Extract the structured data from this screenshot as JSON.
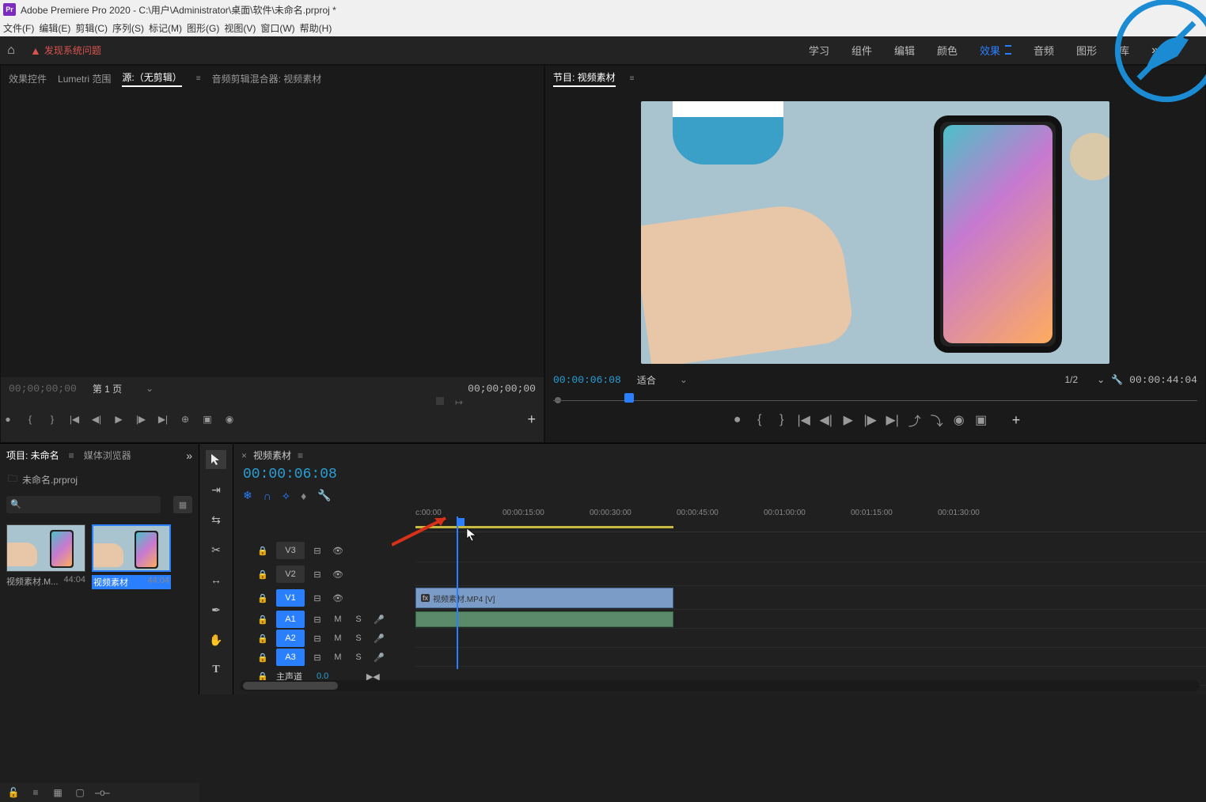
{
  "title": "Adobe Premiere Pro 2020 - C:\\用户\\Administrator\\桌面\\软件\\未命名.prproj *",
  "pr_badge": "Pr",
  "menubar": [
    "文件(F)",
    "编辑(E)",
    "剪辑(C)",
    "序列(S)",
    "标记(M)",
    "图形(G)",
    "视图(V)",
    "窗口(W)",
    "帮助(H)"
  ],
  "alert_text": "发现系统问题",
  "workspaces": [
    "学习",
    "组件",
    "编辑",
    "颜色",
    "效果",
    "音频",
    "图形",
    "库"
  ],
  "workspaces_active": "效果",
  "source_tabs": [
    "效果控件",
    "Lumetri 范围",
    "源:（无剪辑）",
    "音频剪辑混合器: 视频素材"
  ],
  "source_active": "源:（无剪辑）",
  "program_tab": "节目: 视频素材",
  "source_tc_left": "00;00;00;00",
  "source_tc_right": "00;00;00;00",
  "source_fit": "第 1 页",
  "program_tc_left": "00:00:06:08",
  "program_fit": "适合",
  "program_res": "1/2",
  "program_tc_right": "00:00:44:04",
  "project_tabs": [
    "项目: 未命名",
    "媒体浏览器"
  ],
  "project_active": "项目: 未命名",
  "project_file": "未命名.prproj",
  "search_placeholder": "",
  "bins": [
    {
      "name": "视频素材.M...",
      "dur": "44:04",
      "selected": false
    },
    {
      "name": "视频素材",
      "dur": "44:04",
      "selected": true
    }
  ],
  "seq_name": "视频素材",
  "tl_tc": "00:00:06:08",
  "tl_ticks": [
    "c:00:00",
    "00:00:15:00",
    "00:00:30:00",
    "00:00:45:00",
    "00:01:00:00",
    "00:01:15:00",
    "00:01:30:00"
  ],
  "tracks_v": [
    "V3",
    "V2",
    "V1"
  ],
  "tracks_a": [
    "A1",
    "A2",
    "A3"
  ],
  "clip_label": "视频素材.MP4 [V]",
  "mix_label": "主声道",
  "mix_value": "0.0",
  "colors": {
    "accent_blue": "#2a7fff",
    "tc_blue": "#2a9fd6",
    "warn": "#d9534f"
  }
}
